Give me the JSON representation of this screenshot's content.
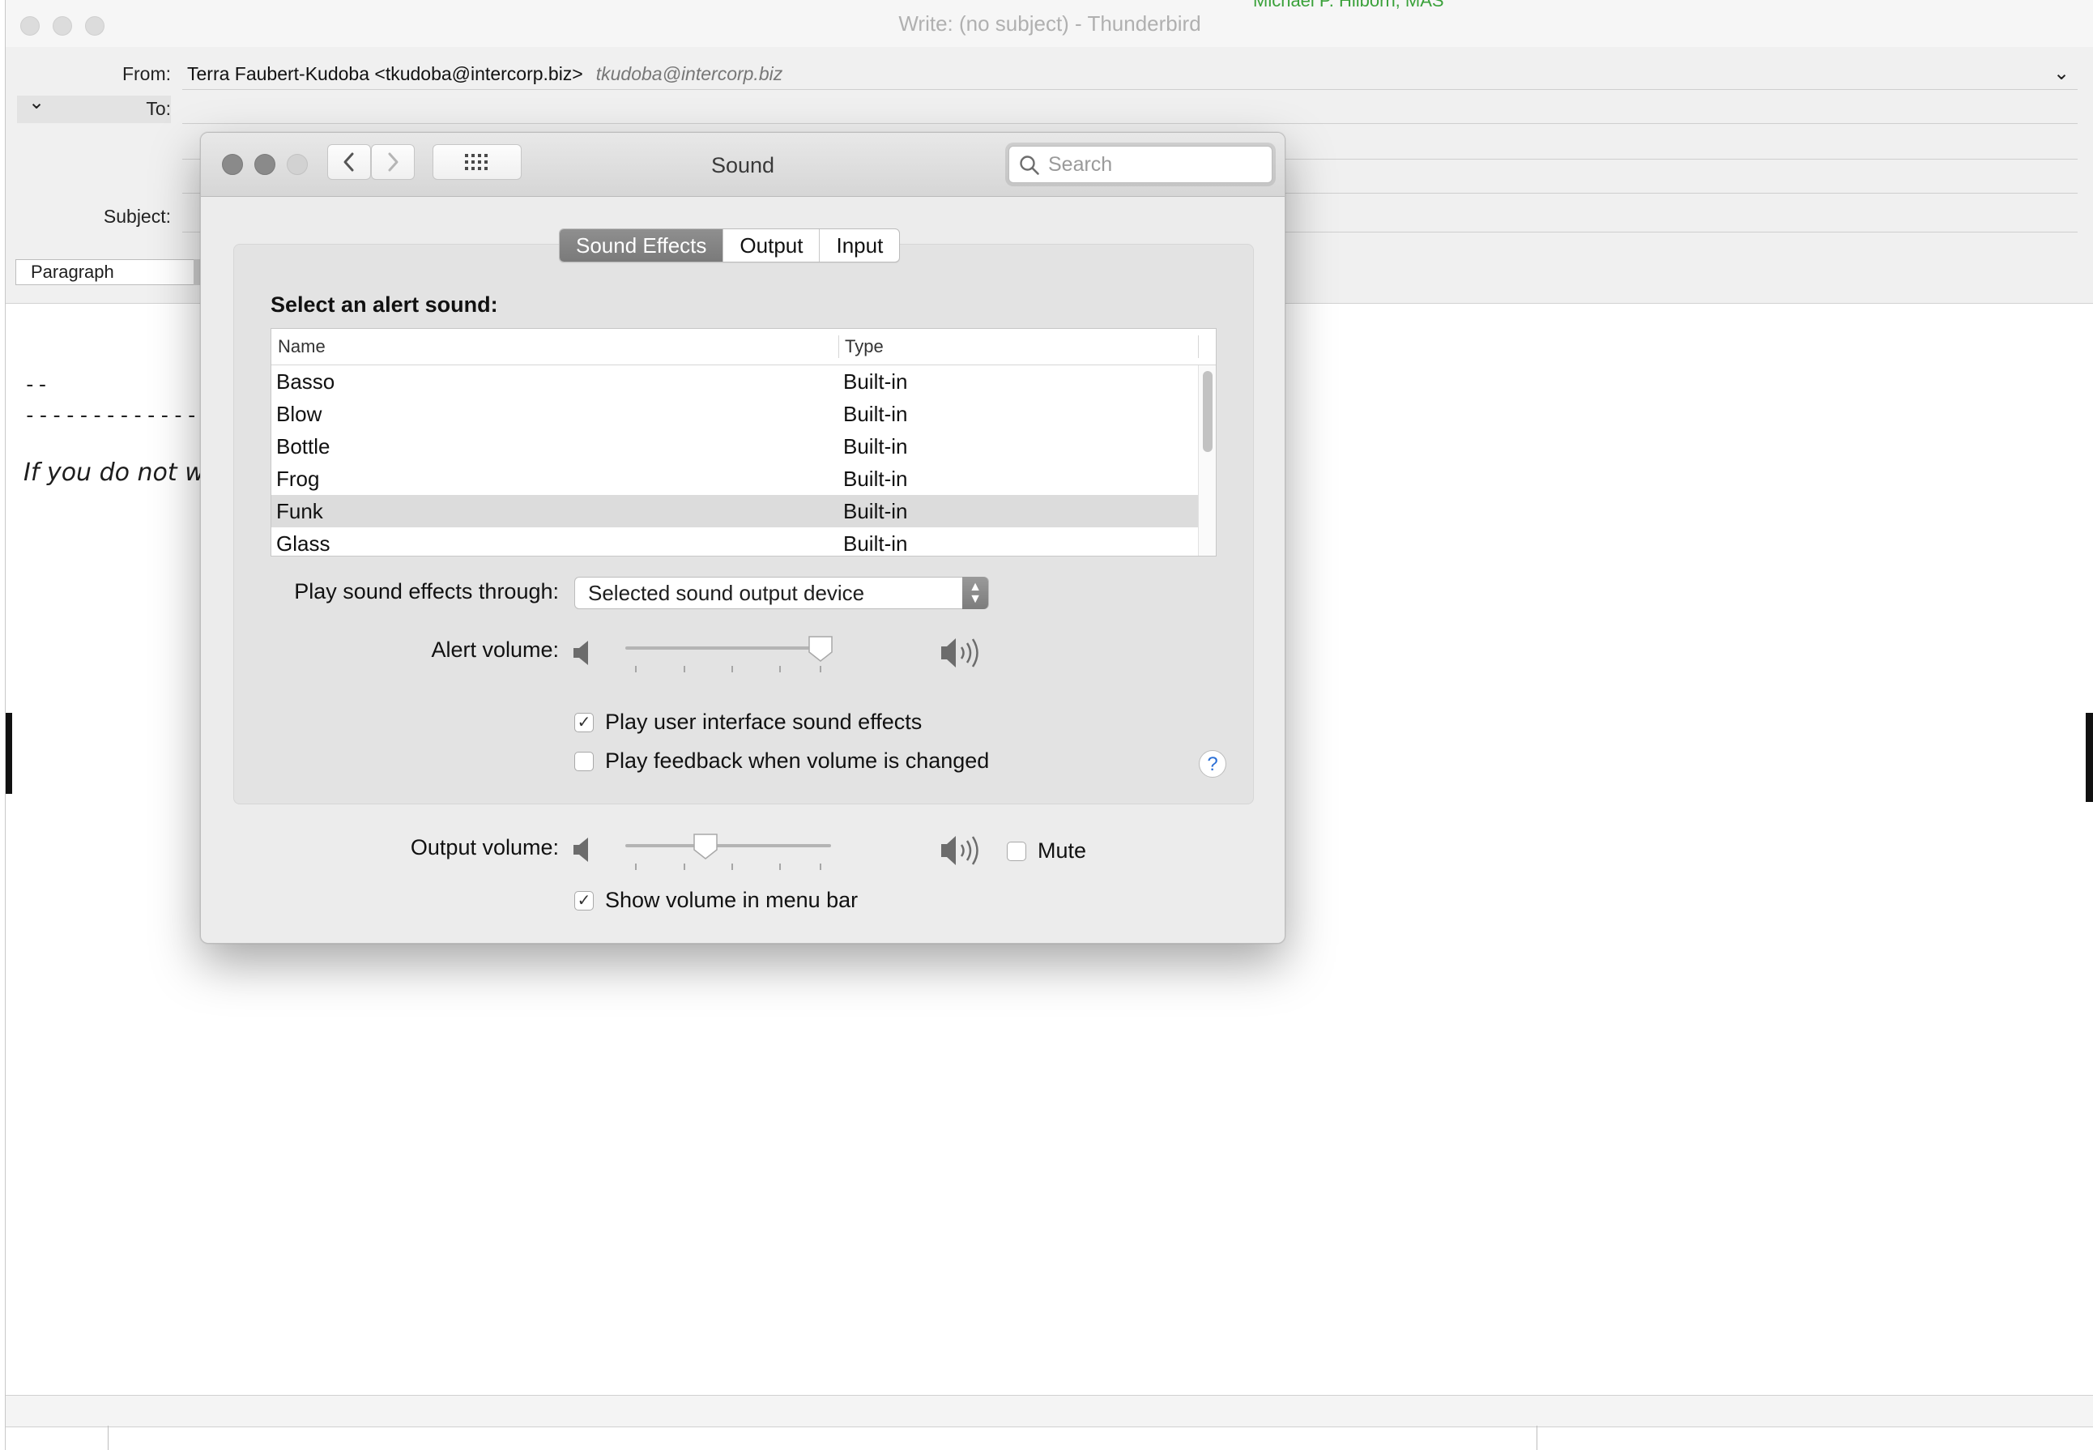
{
  "thunderbird": {
    "window_title": "Write: (no subject) - Thunderbird",
    "behind_text": "Michael P. Hilborn, MAS",
    "from_label": "From:",
    "from_value": "Terra Faubert-Kudoba <tkudoba@intercorp.biz>",
    "from_identity": "tkudoba@intercorp.biz",
    "to_label": "To:",
    "subject_label": "Subject:",
    "paragraph_format": "Paragraph",
    "body_sig_dash": "--",
    "body_rule": "--------------",
    "body_italic": "If you do not wi"
  },
  "sound_prefs": {
    "title": "Sound",
    "search_placeholder": "Search",
    "tabs": [
      "Sound Effects",
      "Output",
      "Input"
    ],
    "active_tab": "Sound Effects",
    "select_label": "Select an alert sound:",
    "columns": [
      "Name",
      "Type"
    ],
    "sounds": [
      {
        "name": "Basso",
        "type": "Built-in"
      },
      {
        "name": "Blow",
        "type": "Built-in"
      },
      {
        "name": "Bottle",
        "type": "Built-in"
      },
      {
        "name": "Frog",
        "type": "Built-in"
      },
      {
        "name": "Funk",
        "type": "Built-in"
      },
      {
        "name": "Glass",
        "type": "Built-in"
      }
    ],
    "selected_sound": "Funk",
    "play_through_label": "Play sound effects through:",
    "play_through_value": "Selected sound output device",
    "alert_volume_label": "Alert volume:",
    "alert_volume": 0.95,
    "ui_sounds_label": "Play user interface sound effects",
    "ui_sounds_checked": true,
    "feedback_label": "Play feedback when volume is changed",
    "feedback_checked": false,
    "help_label": "?",
    "output_volume_label": "Output volume:",
    "output_volume": 0.39,
    "mute_label": "Mute",
    "mute_checked": false,
    "menubar_label": "Show volume in menu bar",
    "menubar_checked": true
  },
  "colors": {
    "traffic_close": "#8a8a8a",
    "traffic_min": "#8a8a8a",
    "traffic_zoom": "#d2d2d2",
    "selected_row": "#dcdcdc",
    "tab_active": "#828282"
  }
}
